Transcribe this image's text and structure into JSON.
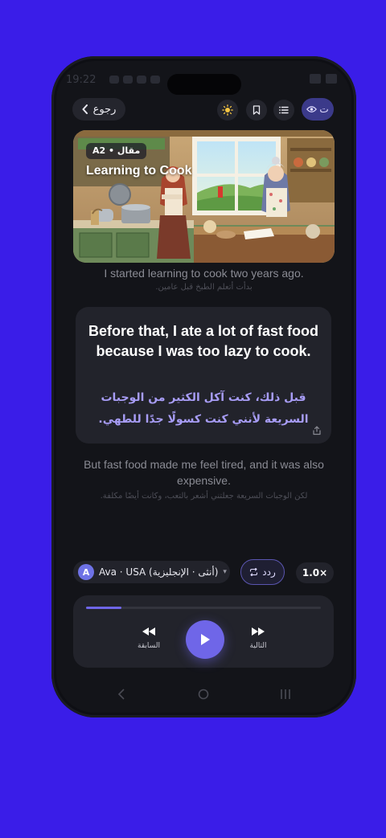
{
  "status_bar": {
    "time": "19:22"
  },
  "header": {
    "back_label": "رجوع",
    "translation_toggle_label": "ت"
  },
  "article": {
    "level_badge": "A2 • مقال",
    "title": "Learning to Cook"
  },
  "sentences": {
    "previous": {
      "en": "I started learning to cook two years ago.",
      "ar": "بدأت أتعلم الطبخ قبل عامين."
    },
    "current": {
      "en": "Before that, I ate a lot of fast food because I was too lazy to cook.",
      "ar": "قبل ذلك، كنت آكل الكثير من الوجبات السريعة لأنني كنت كسولًا جدًا للطهي."
    },
    "next": {
      "en": "But fast food made me feel tired, and it was also expensive.",
      "ar": "لكن الوجبات السريعة جعلتني أشعر بالتعب، وكانت أيضًا مكلفة."
    }
  },
  "voice": {
    "avatar_letter": "A",
    "label": "Ava · USA (أنثى · الإنجليزية)"
  },
  "repeat_label": "ردد",
  "speed_label": "1.0×",
  "player": {
    "progress_fraction": 0.15,
    "prev_label": "السابقة",
    "next_label": "التالية"
  },
  "colors": {
    "background": "#3a1de8",
    "accent": "#6f66e8",
    "translation_text": "#a79cf5"
  },
  "icons": [
    "chevron-left-icon",
    "sun-icon",
    "bookmark-icon",
    "list-icon",
    "eye-icon",
    "share-icon",
    "repeat-icon",
    "rewind-icon",
    "play-icon",
    "fast-forward-icon"
  ]
}
